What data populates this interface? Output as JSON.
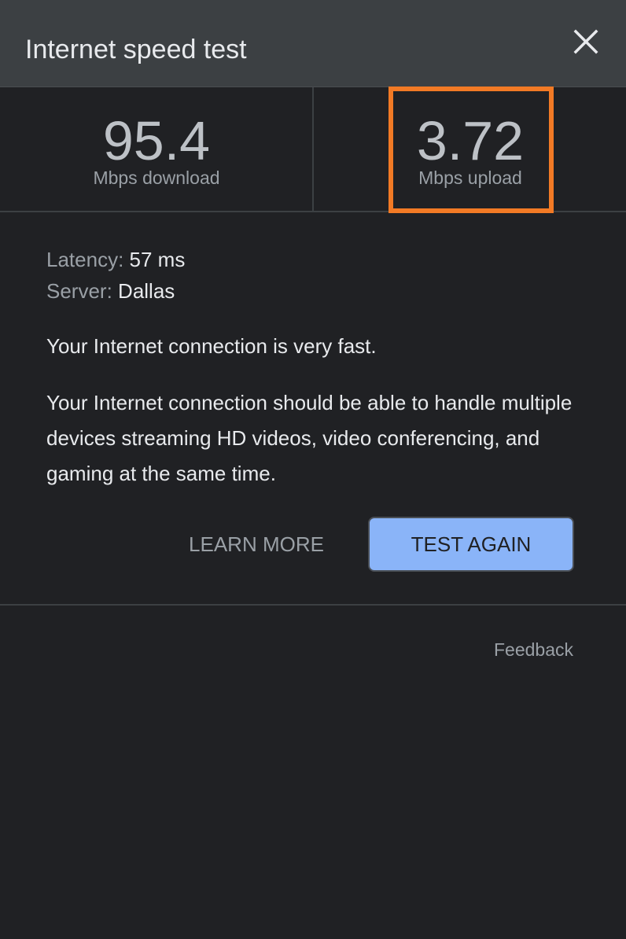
{
  "header": {
    "title": "Internet speed test",
    "close_icon": "close-icon"
  },
  "results": {
    "download": {
      "value": "95.4",
      "unit": "Mbps download"
    },
    "upload": {
      "value": "3.72",
      "unit": "Mbps upload"
    },
    "highlight_color": "#f27a25"
  },
  "details": {
    "latency_label": "Latency:",
    "latency_value": "57 ms",
    "server_label": "Server:",
    "server_value": "Dallas"
  },
  "summary": "Your Internet connection is very fast.",
  "description": "Your Internet connection should be able to handle multiple devices streaming HD videos, video conferencing, and gaming at the same time.",
  "actions": {
    "learn_more": "LEARN MORE",
    "test_again": "TEST AGAIN"
  },
  "footer": {
    "feedback": "Feedback"
  },
  "colors": {
    "background": "#202124",
    "header": "#3c4043",
    "accent_button": "#8ab4f8"
  }
}
